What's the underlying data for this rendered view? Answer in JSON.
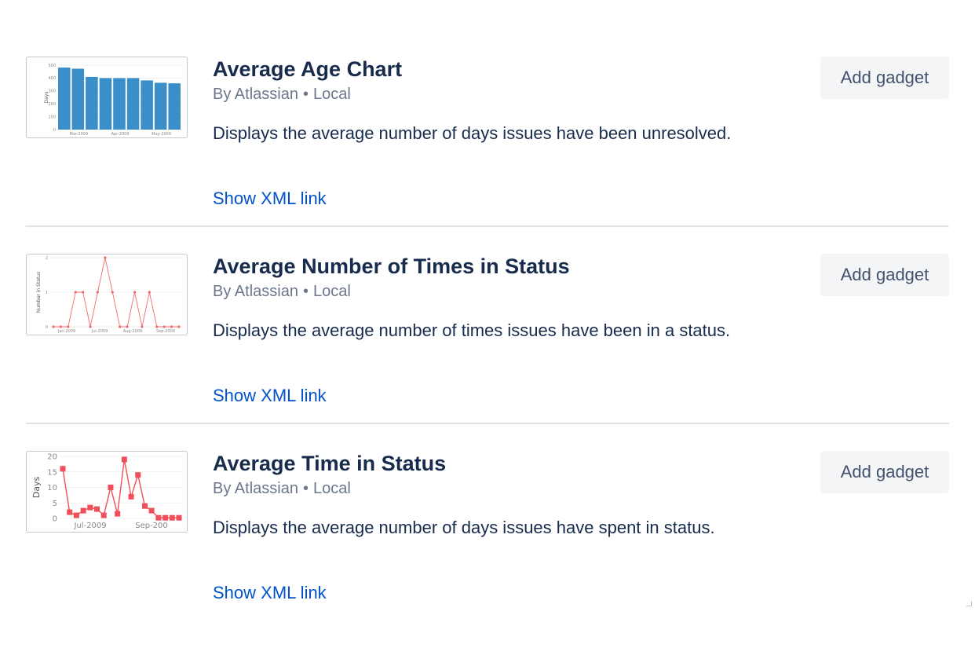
{
  "gadgets": [
    {
      "title": "Average Age Chart",
      "author": "By Atlassian",
      "separator": "•",
      "source": "Local",
      "description": "Displays the average number of days issues have been unresolved.",
      "xml_link": "Show XML link",
      "add_button": "Add gadget",
      "preview_icon": "bar-chart-thumbnail-icon"
    },
    {
      "title": "Average Number of Times in Status",
      "author": "By Atlassian",
      "separator": "•",
      "source": "Local",
      "description": "Displays the average number of times issues have been in a status.",
      "xml_link": "Show XML link",
      "add_button": "Add gadget",
      "preview_icon": "line-chart-thumbnail-icon"
    },
    {
      "title": "Average Time in Status",
      "author": "By Atlassian",
      "separator": "•",
      "source": "Local",
      "description": "Displays the average number of days issues have spent in status.",
      "xml_link": "Show XML link",
      "add_button": "Add gadget",
      "preview_icon": "line-chart-thumbnail-icon"
    }
  ],
  "thumbnails": {
    "age": {
      "ylabel": "Days",
      "yticks": [
        "500",
        "400",
        "300",
        "200",
        "100",
        "0"
      ],
      "xticks": [
        "Mar-2009",
        "Apr-2009",
        "May-2009"
      ],
      "values": [
        530,
        520,
        450,
        440,
        440,
        440,
        420,
        400,
        395
      ],
      "ymax": 550,
      "color": "#3a8fc8"
    },
    "times": {
      "ylabel": "Number in Status",
      "yticks": [
        "2",
        "1",
        "0"
      ],
      "xticks": [
        "Jan-2009",
        "Jul-2009",
        "Aug-2009",
        "Sep-2009"
      ],
      "values": [
        0,
        0,
        0,
        1,
        1,
        0,
        1,
        2,
        1,
        0,
        0,
        1,
        0,
        1,
        0,
        0,
        0,
        0
      ],
      "ymax": 2,
      "color": "#f26b6b"
    },
    "time": {
      "ylabel": "Days",
      "yticks": [
        "20",
        "15",
        "10",
        "5",
        "0"
      ],
      "xticks": [
        "Jul-2009",
        "Sep-200"
      ],
      "values": [
        16,
        2,
        1,
        2.5,
        3.5,
        3,
        1,
        10,
        1.5,
        19,
        7,
        14,
        4,
        2.5,
        0.2,
        0.2,
        0.2,
        0.2
      ],
      "ymax": 20,
      "color": "#f04f5a"
    }
  },
  "colors": {
    "title": "#172b4d",
    "meta": "#6b778c",
    "link": "#0052cc",
    "button_bg": "#f4f5f7",
    "button_text": "#42526e",
    "divider": "#dfe1e6"
  }
}
